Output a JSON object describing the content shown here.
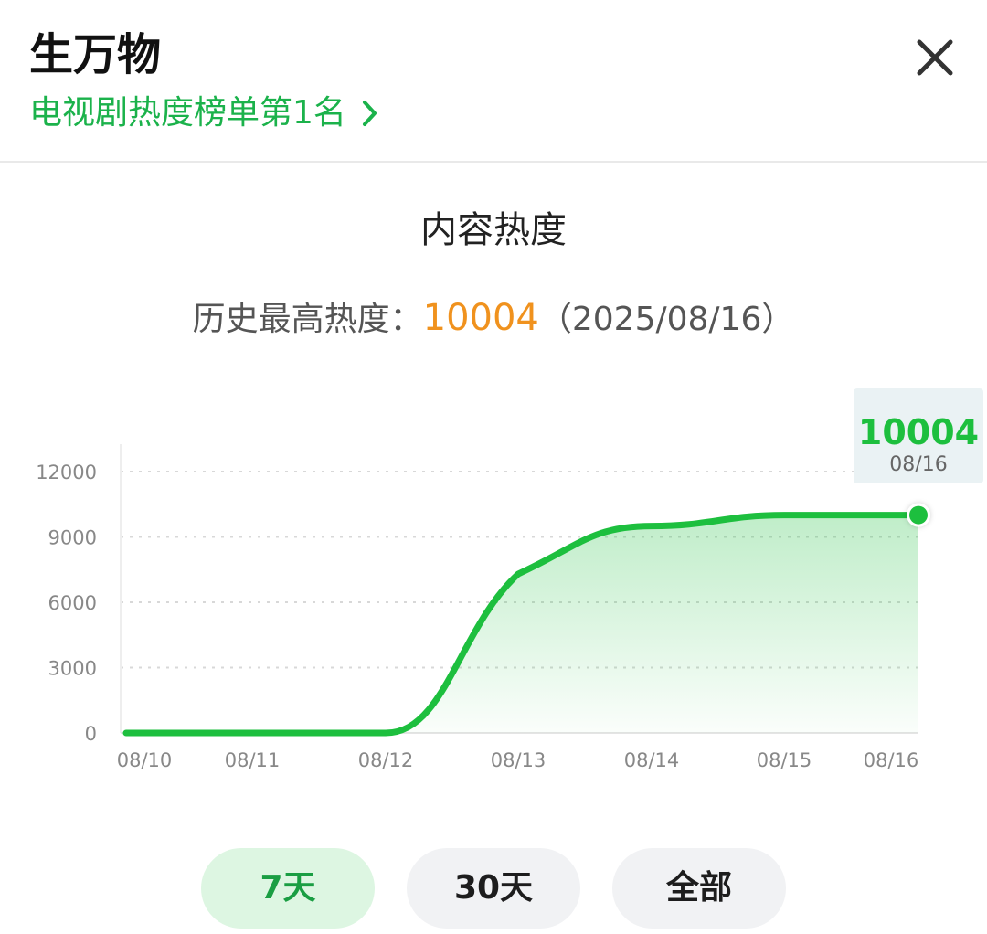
{
  "header": {
    "title": "生万物",
    "rank_link": "电视剧热度榜单第1名",
    "icons": {
      "chevron": "chevron-right-icon",
      "close": "close-icon"
    }
  },
  "section": {
    "title": "内容热度",
    "peak_label": "历史最高热度：",
    "peak_value": "10004",
    "peak_date": "（2025/08/16）"
  },
  "colors": {
    "accent": "#1bb24b",
    "line": "#1dbf3e",
    "peak_value": "#f0921e",
    "tab_active_bg": "#ddf6e2",
    "tab_bg": "#f1f2f4"
  },
  "chart_data": {
    "type": "area",
    "x": [
      "08/10",
      "08/11",
      "08/12",
      "08/13",
      "08/14",
      "08/15",
      "08/16"
    ],
    "values": [
      0,
      0,
      0,
      7300,
      9500,
      10000,
      10004
    ],
    "ylim": [
      0,
      12000
    ],
    "yticks": [
      0,
      3000,
      6000,
      9000,
      12000
    ],
    "grid": true,
    "highlight": {
      "value": "10004",
      "date": "08/16"
    }
  },
  "tabs": [
    {
      "label": "7天",
      "active": true
    },
    {
      "label": "30天",
      "active": false
    },
    {
      "label": "全部",
      "active": false
    }
  ]
}
